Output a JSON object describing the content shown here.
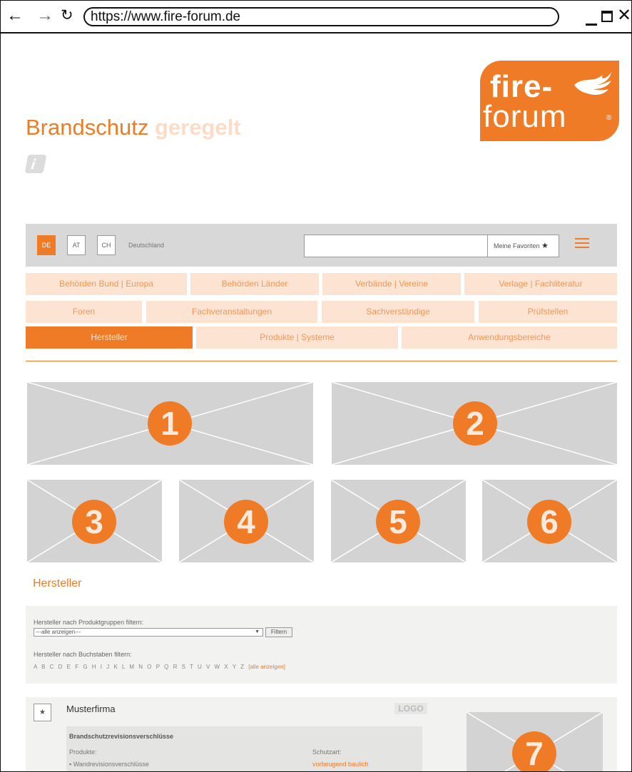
{
  "browser": {
    "back_icon": "arrow-left",
    "forward_icon": "arrow-right",
    "reload_icon": "reload",
    "url": "https://www.fire-forum.de",
    "close_symbol": "✕"
  },
  "header": {
    "headline_main": "Brandschutz",
    "headline_accent": "geregelt",
    "info_symbol": "i",
    "logo_line1": "fire-",
    "logo_line2": "forum",
    "logo_reg": "®"
  },
  "toolbar": {
    "languages": [
      {
        "label": "DE",
        "active": true
      },
      {
        "label": "AT",
        "active": false
      },
      {
        "label": "CH",
        "active": false
      }
    ],
    "country": "Deutschland",
    "search_value": "",
    "search_icon": "⚲",
    "favorites_label": "Meine Favoriten",
    "favorites_icon": "★"
  },
  "nav": {
    "row1": [
      "Behörden Bund | Europa",
      "Behörden Länder",
      "Verbände | Vereine",
      "Verlage | Fachliteratur"
    ],
    "row2": [
      "Foren",
      "Fachveranstaltungen",
      "Sachverständige",
      "Prüfstellen"
    ],
    "row3": [
      "Hersteller",
      "Produkte | Systeme",
      "Anwendungsbereiche"
    ],
    "active": "Hersteller"
  },
  "tiles": [
    "1",
    "2",
    "3",
    "4",
    "5",
    "6",
    "7"
  ],
  "section": {
    "title": "Hersteller"
  },
  "filter": {
    "group_label": "Hersteller nach Produktgruppen filtern:",
    "group_select_value": "---alle anzeigen---",
    "select_arrow": "▼",
    "filter_button": "Filtern",
    "letters_label": "Hersteller nach Buchstaben filtern:",
    "letters": "A B C D E F G H I J K L M N O P Q R S T U V W X Y Z",
    "all_link": "[alle anzeigen]"
  },
  "result": {
    "favorite_icon": "★",
    "company": "Musterfirma",
    "logo_placeholder": "LOGO",
    "group": "Brandschutzrevisionsverschlüsse",
    "products_label": "Produkte:",
    "product_item": "▪ Wandrevisionsverschlüsse",
    "protection_label": "Schutzart:",
    "protection_value": "vorbeugend baulich"
  },
  "colors": {
    "brand_orange": "#f07b26",
    "nav_light": "#fde4d2",
    "placeholder_gray": "#d3d3d3"
  }
}
